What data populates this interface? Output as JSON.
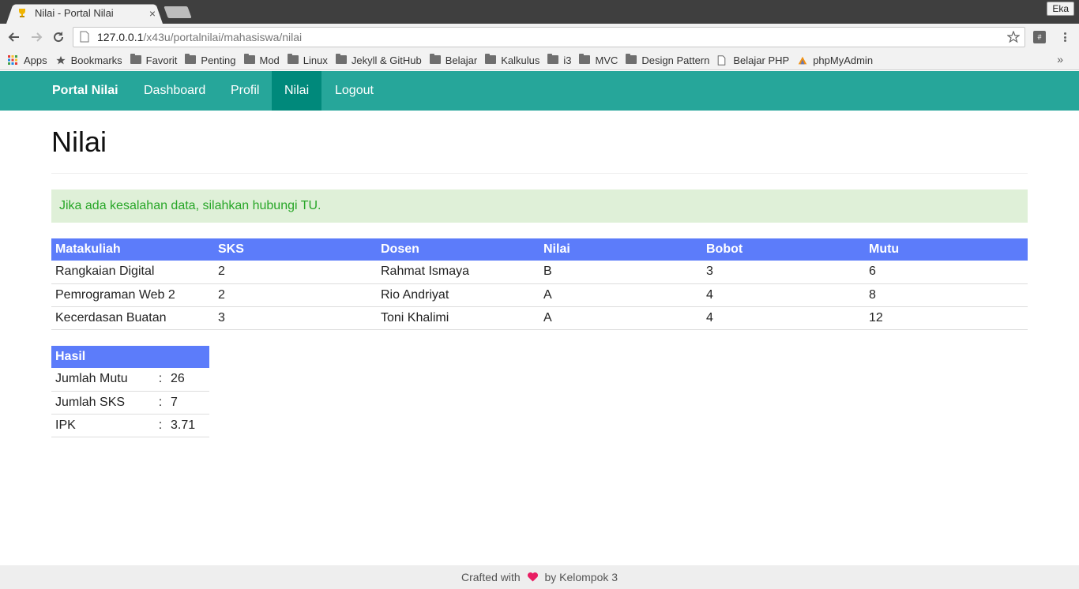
{
  "browser": {
    "tab_title": "Nilai - Portal Nilai",
    "profile": "Eka",
    "url_host": "127.0.0.1",
    "url_path": "/x43u/portalnilai/mahasiswa/nilai",
    "bookmarks": [
      "Apps",
      "Bookmarks",
      "Favorit",
      "Penting",
      "Mod",
      "Linux",
      "Jekyll & GitHub",
      "Belajar",
      "Kalkulus",
      "i3",
      "MVC",
      "Design Pattern",
      "Belajar PHP",
      "phpMyAdmin"
    ],
    "bookmarks_more": "»"
  },
  "navbar": {
    "brand": "Portal Nilai",
    "items": [
      "Dashboard",
      "Profil",
      "Nilai",
      "Logout"
    ],
    "active": "Nilai",
    "color": "#26a69a",
    "active_color": "#00897b"
  },
  "page": {
    "title": "Nilai",
    "alert": "Jika ada kesalahan data, silahkan hubungi TU."
  },
  "grades": {
    "headers": [
      "Matakuliah",
      "SKS",
      "Dosen",
      "Nilai",
      "Bobot",
      "Mutu"
    ],
    "rows": [
      [
        "Rangkaian Digital",
        "2",
        "Rahmat Ismaya",
        "B",
        "3",
        "6"
      ],
      [
        "Pemrograman Web 2",
        "2",
        "Rio Andriyat",
        "A",
        "4",
        "8"
      ],
      [
        "Kecerdasan Buatan",
        "3",
        "Toni Khalimi",
        "A",
        "4",
        "12"
      ]
    ],
    "header_color": "#5c7cfa"
  },
  "summary": {
    "header": "Hasil",
    "rows": [
      [
        "Jumlah Mutu",
        ":",
        "26"
      ],
      [
        "Jumlah SKS",
        ":",
        "7"
      ],
      [
        "IPK",
        ":",
        "3.71"
      ]
    ]
  },
  "footer": {
    "prefix": "Crafted with",
    "icon": "heart-icon",
    "suffix": "by Kelompok 3"
  }
}
